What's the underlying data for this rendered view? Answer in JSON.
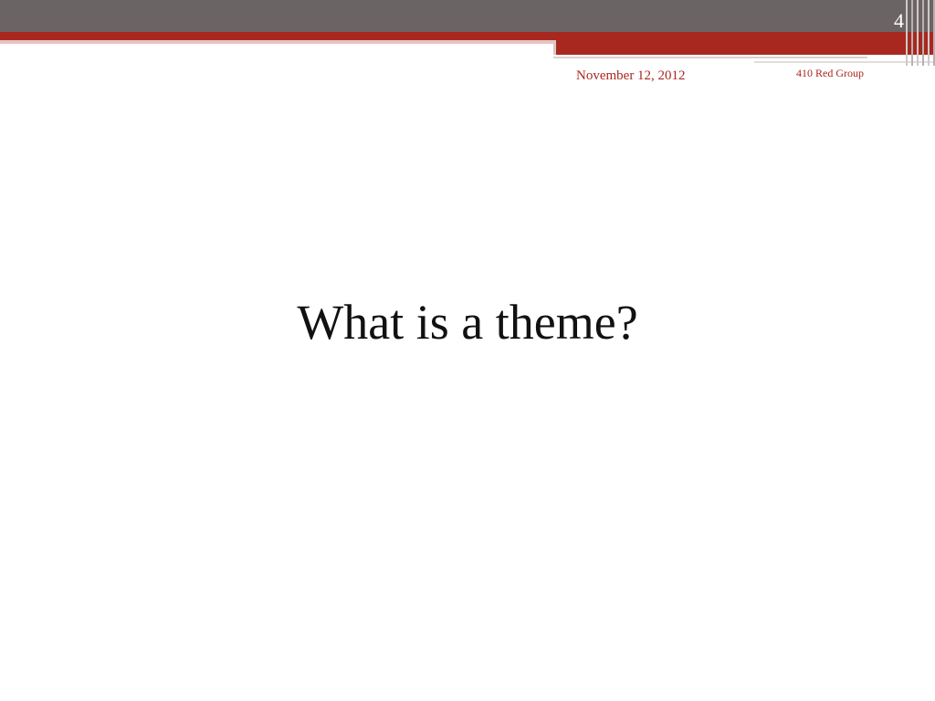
{
  "slide": {
    "number": "4",
    "date": "November 12, 2012",
    "footer_group": "410 Red Group",
    "title": "What is a theme?"
  },
  "theme": {
    "header_gray": "#6b6464",
    "accent_red": "#a8281f",
    "text": "#111111",
    "background": "#ffffff"
  }
}
